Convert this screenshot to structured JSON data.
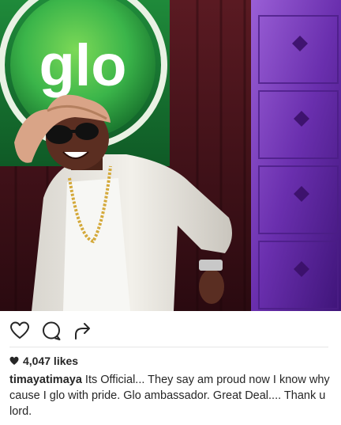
{
  "post": {
    "image_alt": "Performer in white outfit and pink hat on stage in front of a glo logo",
    "logo_text": "glo",
    "likes_text": "4,047 likes",
    "username": "timayatimaya",
    "caption": "Its Official... They say am proud now I know why cause I glo with pride. Glo ambassador. Great Deal.... Thank u lord."
  },
  "icons": {
    "like": "heart-outline-icon",
    "comment": "speech-bubble-icon",
    "share": "share-arrow-icon",
    "likes_marker": "heart-filled-icon"
  },
  "colors": {
    "logo_green": "#3bb54a",
    "text": "#262626",
    "purple_wall": "#7a3fb3"
  }
}
